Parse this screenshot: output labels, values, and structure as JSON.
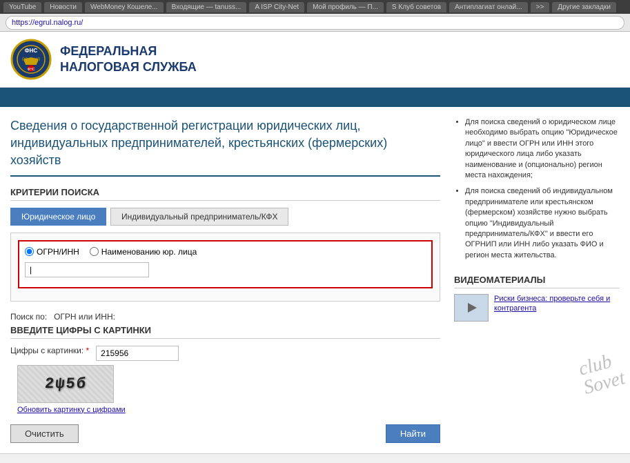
{
  "browser": {
    "tabs": [
      {
        "label": "YouTube",
        "active": false
      },
      {
        "label": "Новости",
        "active": false
      },
      {
        "label": "WebMoney Кошеле...",
        "active": false
      },
      {
        "label": "Входящие — tanuss...",
        "active": false
      },
      {
        "label": "A ISP City-Net",
        "active": false
      },
      {
        "label": "Мой профиль — П...",
        "active": false
      },
      {
        "label": "S Клуб советов",
        "active": false
      },
      {
        "label": "Антиплагиат онлай...",
        "active": false
      },
      {
        "label": ">>",
        "active": false
      },
      {
        "label": "Другие закладки",
        "active": false
      }
    ],
    "address": "https://egrul.nalog.ru/"
  },
  "header": {
    "org_name_line1": "ФЕДЕРАЛЬНАЯ",
    "org_name_line2": "НАЛОГОВАЯ СЛУЖБА"
  },
  "page": {
    "title": "Сведения о государственной регистрации юридических лиц, индивидуальных предпринимателей, крестьянских (фермерских) хозяйств"
  },
  "search_section": {
    "heading": "КРИТЕРИИ ПОИСКА",
    "tabs": [
      {
        "label": "Юридическое лицо",
        "active": true
      },
      {
        "label": "Индивидуальный предприниматель/КФХ",
        "active": false
      }
    ],
    "search_by_label": "Поиск по:",
    "search_options": [
      {
        "label": "ОГРН/ИНН",
        "value": "ogrn",
        "checked": true
      },
      {
        "label": "Наименованию юр. лица",
        "value": "name",
        "checked": false
      }
    ],
    "ogrn_label": "ОГРН или ИНН:",
    "ogrn_value": ""
  },
  "captcha_section": {
    "heading": "ВВЕДИТЕ ЦИФРЫ С КАРТИНКИ",
    "label": "Цифры с картинки:",
    "required": "*",
    "value": "215956",
    "captcha_display": "2ψ5б",
    "refresh_link": "Обновить картинку с цифрами"
  },
  "buttons": {
    "clear": "Очистить",
    "search": "Найти"
  },
  "info_section": {
    "items": [
      "Для поиска сведений о юридическом лице необходимо выбрать опцию \"Юридическое лицо\" и ввести ОГРН или ИНН этого юридического лица либо указать наименование и (опционально) регион места нахождения;",
      "Для поиска сведений об индивидуальном предпринимателе или крестьянском (фермерском) хозяйстве нужно выбрать опцию \"Индивидуальный предприниматель/КФХ\" и ввести его ОГРНИП или ИНН либо указать ФИО и регион места жительства."
    ]
  },
  "video_section": {
    "heading": "ВИДЕОМАТЕРИАЛЫ",
    "items": [
      {
        "link": "Риски бизнеса: проверьте себя и контрагента"
      }
    ]
  },
  "watermark": {
    "line1": "club",
    "line2": "Sovet"
  }
}
